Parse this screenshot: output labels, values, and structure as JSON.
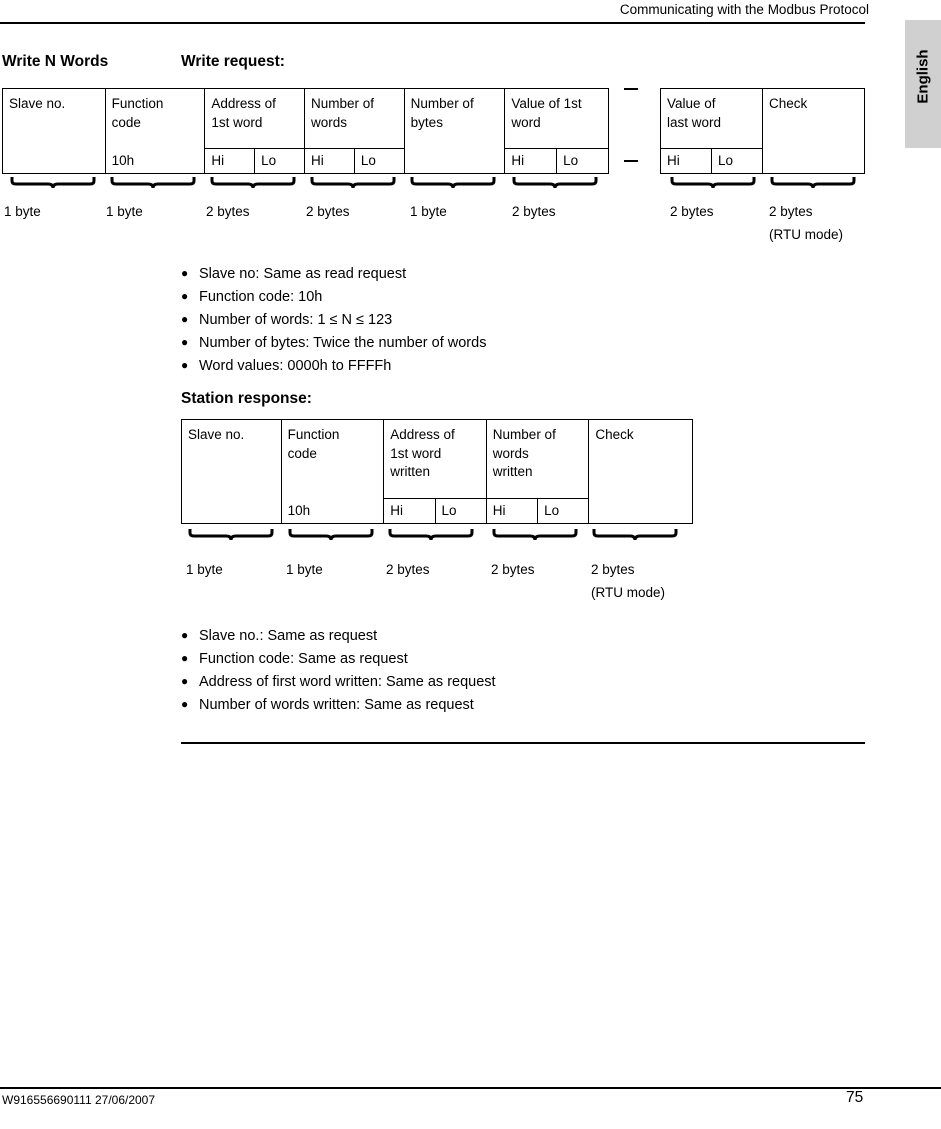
{
  "header": {
    "title": "Communicating with the Modbus Protocol"
  },
  "side_tab": {
    "label": "English"
  },
  "section": {
    "write_n_words_title": "Write N Words",
    "write_request_title": "Write request:",
    "station_response_title": "Station response:"
  },
  "request_frame": {
    "cells": [
      {
        "line1": "Slave no.",
        "line2": "",
        "bottom": ""
      },
      {
        "line1": "Function",
        "line2": "code",
        "bottom": "10h"
      },
      {
        "line1": "Address of",
        "line2": "1st word",
        "hi": "Hi",
        "lo": "Lo"
      },
      {
        "line1": "Number of",
        "line2": "words",
        "hi": "Hi",
        "lo": "Lo"
      },
      {
        "line1": "Number of",
        "line2": "bytes",
        "bottom": ""
      },
      {
        "line1": "Value of 1st",
        "line2": "word",
        "hi": "Hi",
        "lo": "Lo"
      }
    ],
    "cells_right": [
      {
        "line1": "Value of",
        "line2": "last word",
        "hi": "Hi",
        "lo": "Lo"
      },
      {
        "line1": "Check",
        "line2": "",
        "bottom": ""
      }
    ],
    "byte_labels": [
      "1 byte",
      "1 byte",
      "2 bytes",
      "2 bytes",
      "1 byte",
      "2 bytes"
    ],
    "byte_labels_right": [
      "2 bytes",
      "2 bytes"
    ],
    "rtu_note": "(RTU mode)"
  },
  "request_bullets": [
    "Slave no: Same as read request",
    "Function code: 10h",
    "Number of words: 1 ≤ N ≤ 123",
    "Number of bytes: Twice the number of words",
    "Word values: 0000h to FFFFh"
  ],
  "response_frame": {
    "cells": [
      {
        "line1": "Slave no.",
        "line2": "",
        "line3": "",
        "bottom": ""
      },
      {
        "line1": "Function",
        "line2": "code",
        "line3": "",
        "bottom": "10h"
      },
      {
        "line1": "Address of",
        "line2": "1st word",
        "line3": "written",
        "hi": "Hi",
        "lo": "Lo"
      },
      {
        "line1": "Number of",
        "line2": "words",
        "line3": "written",
        "hi": "Hi",
        "lo": "Lo"
      },
      {
        "line1": "Check",
        "line2": "",
        "line3": "",
        "bottom": ""
      }
    ],
    "byte_labels": [
      "1 byte",
      "1 byte",
      "2 bytes",
      "2 bytes",
      "2 bytes"
    ],
    "rtu_note": "(RTU mode)"
  },
  "response_bullets": [
    "Slave no.: Same as request",
    "Function code: Same as request",
    "Address of first word written: Same as request",
    "Number of words written: Same as request"
  ],
  "footer": {
    "doc_ref": "W916556690111 27/06/2007",
    "page_number": "75"
  },
  "icons": {
    "bullet": "●"
  }
}
